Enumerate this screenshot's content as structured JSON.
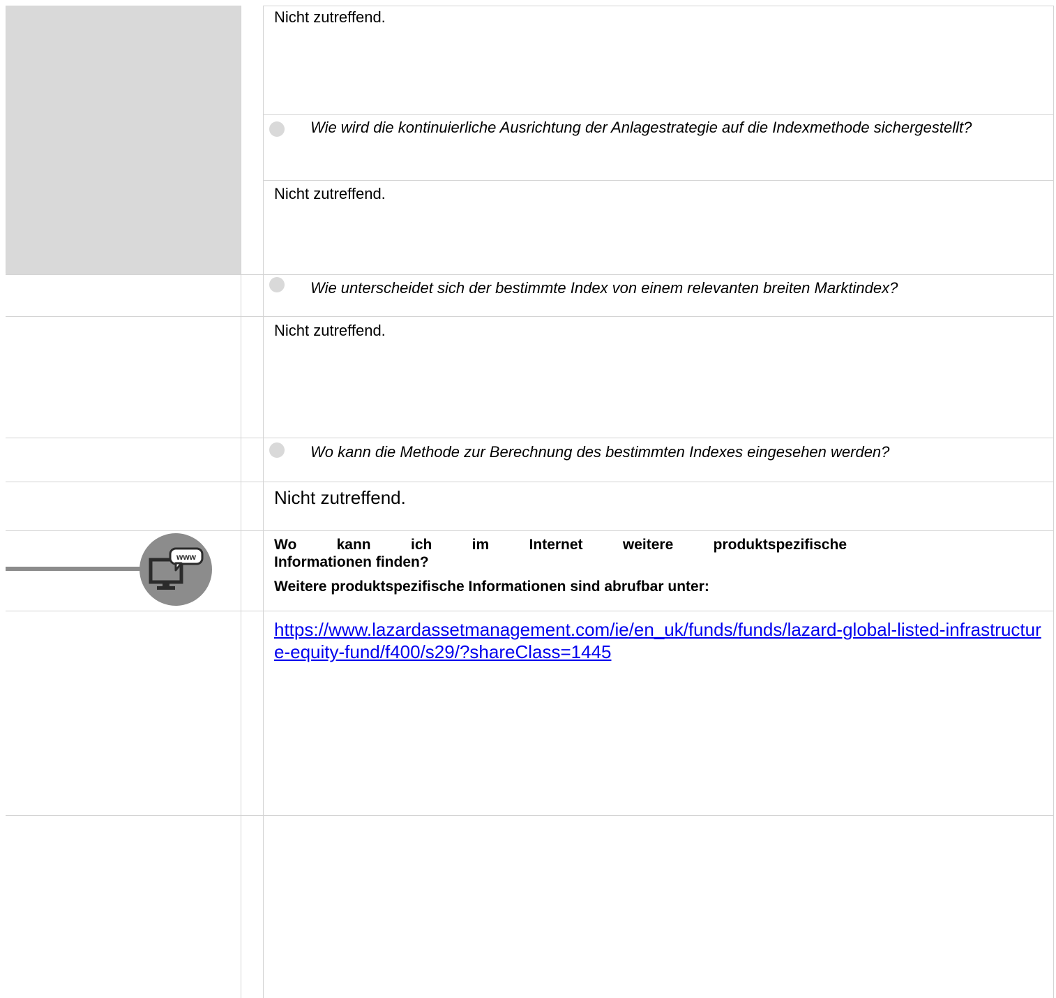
{
  "section_index": {
    "answer_1": "Nicht zutreffend.",
    "question_2": "Wie wird die kontinuierliche Ausrichtung der Anlagestrategie auf die Indexmethode sichergestellt?",
    "answer_2": "Nicht zutreffend.",
    "question_3": "Wie unterscheidet sich der bestimmte Index von einem relevanten breiten Marktindex?",
    "answer_3": "Nicht zutreffend.",
    "question_4": "Wo kann die Methode zur Berechnung des bestimmten Indexes eingesehen werden?",
    "answer_4": "Nicht zutreffend."
  },
  "section_web": {
    "icon_label": "www",
    "heading_line1": "Wo kann ich im Internet weitere produktspezifische",
    "heading_line2": "Informationen finden?",
    "subheading": "Weitere produktspezifische Informationen sind abrufbar unter:",
    "link_text": "https://www.lazardassetmanagement.com/ie/en_uk/funds/funds/lazard-global-listed-infrastructure-equity-fund/f400/s29/?shareClass=1445"
  }
}
